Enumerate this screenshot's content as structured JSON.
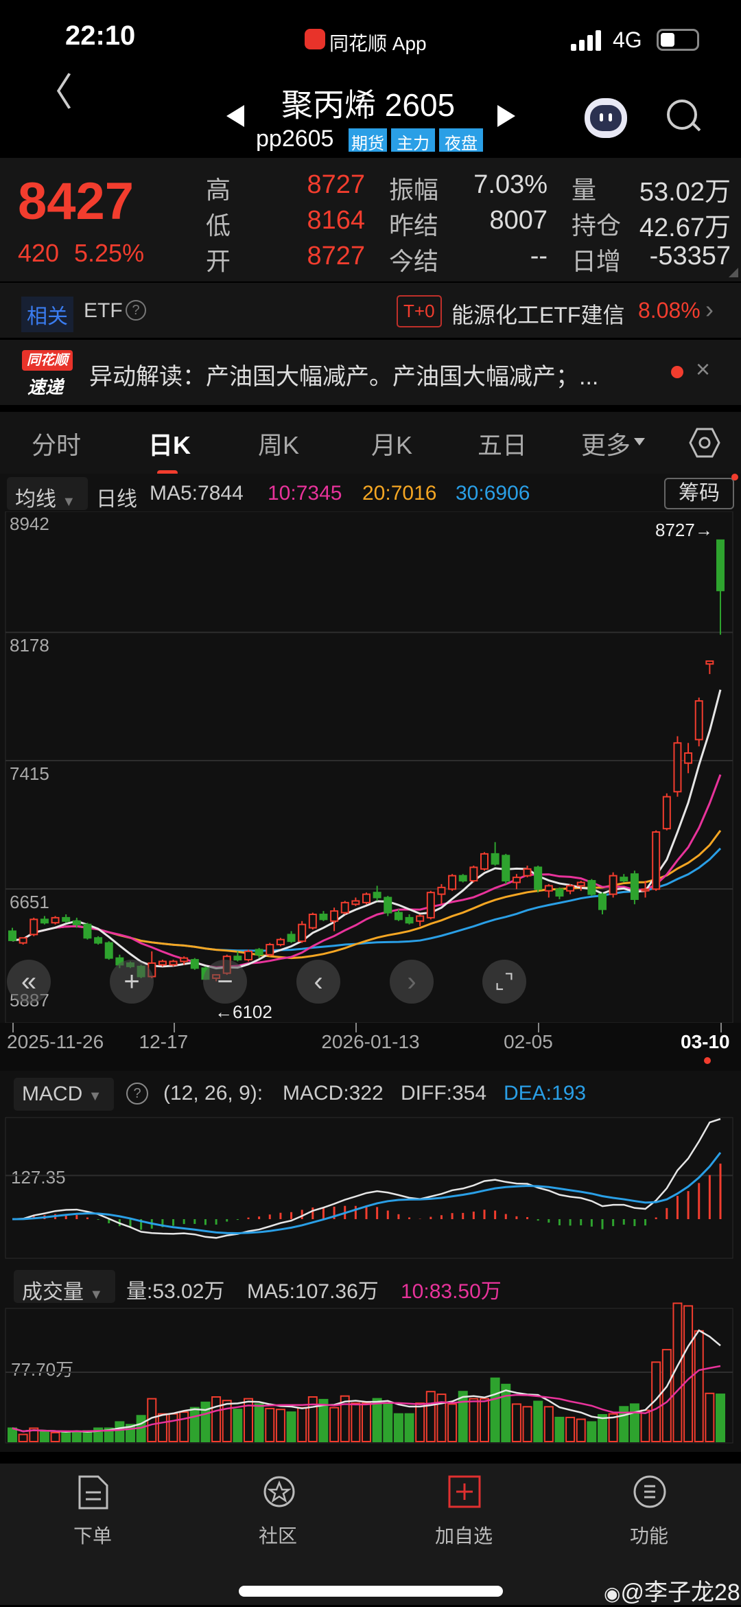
{
  "status": {
    "time": "22:10",
    "app": "同花顺 App",
    "network": "4G"
  },
  "nav": {
    "title": "聚丙烯 2605",
    "code": "pp2605",
    "tags": [
      "期货",
      "主力",
      "夜盘"
    ]
  },
  "quote": {
    "price": "8427",
    "change": "420",
    "change_pct": "5.25%",
    "rows": [
      {
        "l1": "高",
        "v1": "8727",
        "l2": "振幅",
        "v2": "7.03%",
        "l3": "量",
        "v3": "53.02万"
      },
      {
        "l1": "低",
        "v1": "8164",
        "l2": "昨结",
        "v2": "8007",
        "l3": "持仓",
        "v3": "42.67万"
      },
      {
        "l1": "开",
        "v1": "8727",
        "l2": "今结",
        "v2": "--",
        "l3": "日增",
        "v3": "-53357"
      }
    ]
  },
  "etf": {
    "tag": "相关",
    "label": "ETF",
    "badge": "T+0",
    "name": "能源化工ETF建信",
    "pct": "8.08%"
  },
  "news": {
    "logo_top": "同花顺",
    "logo_bottom": "速递",
    "text": "异动解读：产油国大幅减产。产油国大幅减产；..."
  },
  "tabs": [
    "分时",
    "日K",
    "周K",
    "月K",
    "五日",
    "更多"
  ],
  "ma_bar": {
    "selector": "均线",
    "period": "日线",
    "ma5": "MA5:7844",
    "ma10": "10:7345",
    "ma20": "20:7016",
    "ma30": "30:6906",
    "chips": "筹码"
  },
  "colors": {
    "up": "#f23d2e",
    "down": "#2ea32e",
    "ma5": "#e6e6e6",
    "ma10": "#e8339b",
    "ma20": "#f5a623",
    "ma30": "#2a9fe6"
  },
  "chart_data": [
    {
      "type": "candlestick",
      "title": "聚丙烯2605 日K",
      "y_ticks": [
        "8942",
        "8178",
        "7415",
        "6651",
        "5887"
      ],
      "ylim": [
        5887,
        8942
      ],
      "max_label": "8727→",
      "min_label": "←6102",
      "x_labels": [
        {
          "i": 0,
          "t": "2025-11-26"
        },
        {
          "i": 15,
          "t": "12-17"
        },
        {
          "i": 32,
          "t": "2026-01-13"
        },
        {
          "i": 49,
          "t": "02-05"
        },
        {
          "i": 66,
          "t": "03-10"
        }
      ],
      "ohlc": [
        [
          6400,
          6420,
          6340,
          6345
        ],
        [
          6330,
          6360,
          6320,
          6360
        ],
        [
          6380,
          6480,
          6370,
          6470
        ],
        [
          6470,
          6490,
          6440,
          6450
        ],
        [
          6450,
          6490,
          6440,
          6480
        ],
        [
          6480,
          6500,
          6450,
          6460
        ],
        [
          6460,
          6480,
          6420,
          6440
        ],
        [
          6440,
          6450,
          6350,
          6360
        ],
        [
          6360,
          6370,
          6320,
          6330
        ],
        [
          6330,
          6340,
          6230,
          6240
        ],
        [
          6240,
          6260,
          6180,
          6200
        ],
        [
          6210,
          6220,
          6180,
          6190
        ],
        [
          6190,
          6200,
          6120,
          6130
        ],
        [
          6130,
          6280,
          6120,
          6210
        ],
        [
          6200,
          6230,
          6190,
          6220
        ],
        [
          6200,
          6230,
          6190,
          6220
        ],
        [
          6220,
          6250,
          6200,
          6240
        ],
        [
          6230,
          6240,
          6170,
          6180
        ],
        [
          6180,
          6190,
          6110,
          6115
        ],
        [
          6120,
          6140,
          6102,
          6140
        ],
        [
          6150,
          6260,
          6140,
          6250
        ],
        [
          6250,
          6280,
          6220,
          6230
        ],
        [
          6230,
          6290,
          6220,
          6280
        ],
        [
          6290,
          6300,
          6240,
          6260
        ],
        [
          6260,
          6330,
          6250,
          6320
        ],
        [
          6320,
          6360,
          6310,
          6350
        ],
        [
          6380,
          6400,
          6330,
          6340
        ],
        [
          6340,
          6460,
          6330,
          6440
        ],
        [
          6420,
          6510,
          6410,
          6500
        ],
        [
          6500,
          6520,
          6460,
          6470
        ],
        [
          6460,
          6540,
          6400,
          6520
        ],
        [
          6510,
          6580,
          6500,
          6570
        ],
        [
          6560,
          6600,
          6550,
          6580
        ],
        [
          6570,
          6630,
          6560,
          6620
        ],
        [
          6630,
          6670,
          6580,
          6600
        ],
        [
          6600,
          6610,
          6490,
          6510
        ],
        [
          6510,
          6530,
          6460,
          6470
        ],
        [
          6480,
          6500,
          6440,
          6450
        ],
        [
          6460,
          6500,
          6430,
          6490
        ],
        [
          6480,
          6640,
          6470,
          6630
        ],
        [
          6620,
          6680,
          6560,
          6660
        ],
        [
          6650,
          6740,
          6640,
          6730
        ],
        [
          6730,
          6740,
          6690,
          6700
        ],
        [
          6700,
          6790,
          6690,
          6780
        ],
        [
          6770,
          6870,
          6760,
          6860
        ],
        [
          6860,
          6930,
          6790,
          6800
        ],
        [
          6850,
          6860,
          6680,
          6700
        ],
        [
          6690,
          6740,
          6650,
          6720
        ],
        [
          6730,
          6790,
          6720,
          6770
        ],
        [
          6780,
          6790,
          6630,
          6650
        ],
        [
          6640,
          6680,
          6600,
          6670
        ],
        [
          6650,
          6660,
          6590,
          6610
        ],
        [
          6640,
          6680,
          6620,
          6670
        ],
        [
          6670,
          6700,
          6640,
          6690
        ],
        [
          6700,
          6710,
          6610,
          6620
        ],
        [
          6620,
          6630,
          6500,
          6530
        ],
        [
          6620,
          6750,
          6600,
          6730
        ],
        [
          6720,
          6740,
          6690,
          6700
        ],
        [
          6740,
          6760,
          6560,
          6590
        ],
        [
          6640,
          6700,
          6600,
          6650
        ],
        [
          6650,
          7000,
          6640,
          6990
        ],
        [
          7010,
          7220,
          7000,
          7200
        ],
        [
          7230,
          7560,
          7200,
          7520
        ],
        [
          7400,
          7520,
          7340,
          7460
        ],
        [
          7540,
          7790,
          7500,
          7770
        ],
        [
          7990,
          8007,
          7930,
          8007
        ],
        [
          8727,
          8727,
          8164,
          8427
        ]
      ],
      "ma_periods": [
        5,
        10,
        20,
        30
      ]
    },
    {
      "type": "bar+line",
      "title": "MACD",
      "selector": "MACD",
      "params": "(12, 26, 9):",
      "macd": "MACD:322",
      "diff": "DIFF:354",
      "dea": "DEA:193",
      "y_tick": "127.35"
    },
    {
      "type": "bar",
      "title": "成交量",
      "selector": "成交量",
      "vol": "量:53.02万",
      "ma5": "MA5:107.36万",
      "ma10": "10:83.50万",
      "y_tick": "77.70万",
      "unit": "万",
      "values": [
        15,
        8,
        15,
        11,
        10,
        11,
        11,
        12,
        15,
        15,
        22,
        19,
        29,
        48,
        31,
        31,
        33,
        38,
        44,
        50,
        46,
        36,
        48,
        42,
        37,
        36,
        33,
        38,
        50,
        47,
        38,
        51,
        43,
        43,
        48,
        43,
        31,
        31,
        43,
        56,
        53,
        42,
        56,
        48,
        48,
        71,
        64,
        42,
        39,
        45,
        39,
        27,
        27,
        25,
        22,
        30,
        31,
        39,
        42,
        35,
        89,
        103,
        155,
        152,
        124,
        54,
        53.02
      ]
    }
  ],
  "bottom_nav": [
    "下单",
    "社区",
    "加自选",
    "功能"
  ],
  "watermark": "@李子龙28"
}
